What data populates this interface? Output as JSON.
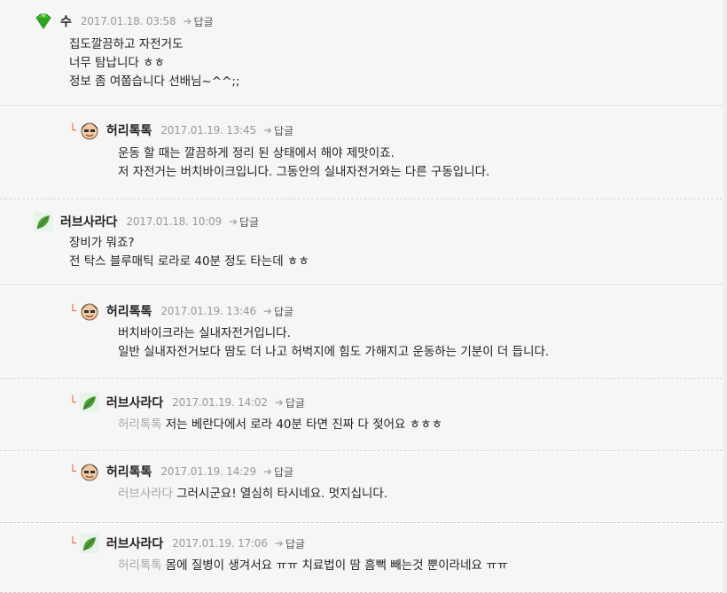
{
  "comments": [
    {
      "author": "수",
      "timestamp": "2017.01.18. 03:58",
      "reply_label": "답글",
      "lines": [
        "집도깔끔하고 자전거도",
        "너무 탐납니다 ㅎㅎ",
        "정보 좀 여쭙습니다 선배님~^^;;"
      ]
    },
    {
      "author": "허리톡톡",
      "timestamp": "2017.01.19. 13:45",
      "reply_label": "답글",
      "lines": [
        "운동 할 때는 깔끔하게 정리 된 상태에서 해야 제맛이죠.",
        "저 자전거는 버치바이크입니다. 그동안의 실내자전거와는 다른 구동입니다."
      ]
    },
    {
      "author": "러브사라다",
      "timestamp": "2017.01.18. 10:09",
      "reply_label": "답글",
      "lines": [
        "장비가 뭐죠?",
        "전 탁스 블루매틱 로라로 40분 정도 타는데 ㅎㅎ"
      ]
    },
    {
      "author": "허리톡톡",
      "timestamp": "2017.01.19. 13:46",
      "reply_label": "답글",
      "lines": [
        "버치바이크라는 실내자전거입니다.",
        "일반 실내자전거보다 땀도 더 나고 허벅지에 힘도 가해지고 운동하는 기분이 더 듭니다."
      ]
    },
    {
      "author": "러브사라다",
      "timestamp": "2017.01.19. 14:02",
      "reply_label": "답글",
      "mention": "허리톡톡",
      "lines": [
        "저는 베란다에서 로라 40분 타면 진짜 다 젖어요 ㅎㅎㅎ"
      ]
    },
    {
      "author": "허리톡톡",
      "timestamp": "2017.01.19. 14:29",
      "reply_label": "답글",
      "mention": "러브사라다",
      "lines": [
        "그러시군요! 열심히 타시네요. 멋지십니다."
      ]
    },
    {
      "author": "러브사라다",
      "timestamp": "2017.01.19. 17:06",
      "reply_label": "답글",
      "mention": "허리톡톡",
      "lines": [
        "몸에 질병이 생겨서요 ㅠㅠ 치료법이 땀 흠뻑 빼는것 뿐이라네요 ㅠㅠ"
      ]
    }
  ],
  "colors": {
    "background": "#f6f6f6",
    "reply_marker": "#e06a3a",
    "mention": "#a8a8a8",
    "meta": "#999999"
  },
  "icons": {
    "gem_avatar": "green-gem-icon",
    "leaf_avatar": "leaf-icon",
    "face_avatar": "face-avatar-icon",
    "reply_marker": "reply-corner-icon"
  }
}
